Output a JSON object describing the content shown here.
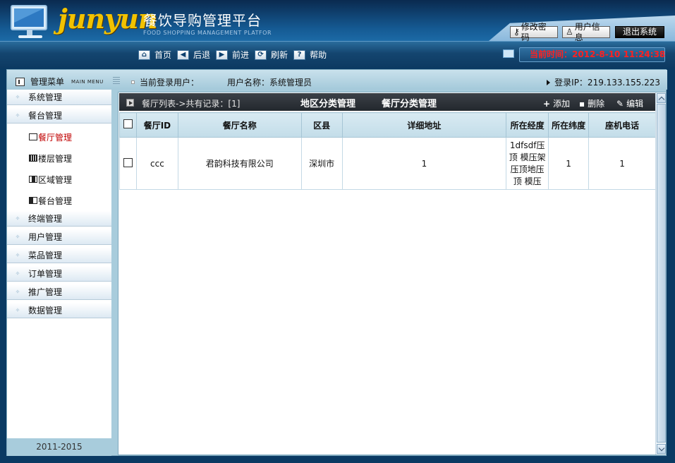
{
  "header": {
    "logo_text": "junyun",
    "title": "餐饮导购管理平台",
    "subtitle": "FOOD SHOPPING MANAGEMENT PLATFOR",
    "buttons": {
      "change_password": "修改密码",
      "user_info": "用户信息",
      "logout": "退出系统"
    },
    "nav": {
      "home": "首页",
      "back": "后退",
      "forward": "前进",
      "refresh": "刷新",
      "help": "帮助"
    },
    "current_time": "当前时间：2012-8-10 11:24:38"
  },
  "infobar": {
    "menu_title": "管理菜单",
    "menu_subtitle": "MAIN MENU",
    "current_user_label": "当前登录用户：",
    "user_name_label": "用户名称：系统管理员",
    "login_ip": "登录IP：219.133.155.223"
  },
  "sidebar": {
    "groups": [
      {
        "label": "系统管理"
      },
      {
        "label": "餐台管理"
      },
      {
        "label": "终端管理"
      },
      {
        "label": "用户管理"
      },
      {
        "label": "菜品管理"
      },
      {
        "label": "订单管理"
      },
      {
        "label": "推广管理"
      },
      {
        "label": "数据管理"
      }
    ],
    "sub_items": [
      {
        "label": "餐厅管理",
        "icon": "square-icon",
        "active": true
      },
      {
        "label": "楼层管理",
        "icon": "grid-icon"
      },
      {
        "label": "区域管理",
        "icon": "area-icon"
      },
      {
        "label": "餐台管理",
        "icon": "table-icon"
      }
    ],
    "footer": "2011-2015"
  },
  "content": {
    "list_header": "餐厅列表->共有记录：[1]",
    "tabs": {
      "region": "地区分类管理",
      "restaurant": "餐厅分类管理"
    },
    "actions": {
      "add": "添加",
      "delete": "删除",
      "edit": "编辑"
    },
    "columns": [
      "餐厅ID",
      "餐厅名称",
      "区县",
      "详细地址",
      "所在经度",
      "所在纬度",
      "座机电话"
    ],
    "rows": [
      {
        "id": "ccc",
        "name": "君韵科技有限公司",
        "district": "深圳市",
        "address": "1",
        "longitude": "1dfsdf压顶 模压架压顶地压顶 模压",
        "latitude": "1",
        "phone": "1"
      }
    ]
  }
}
